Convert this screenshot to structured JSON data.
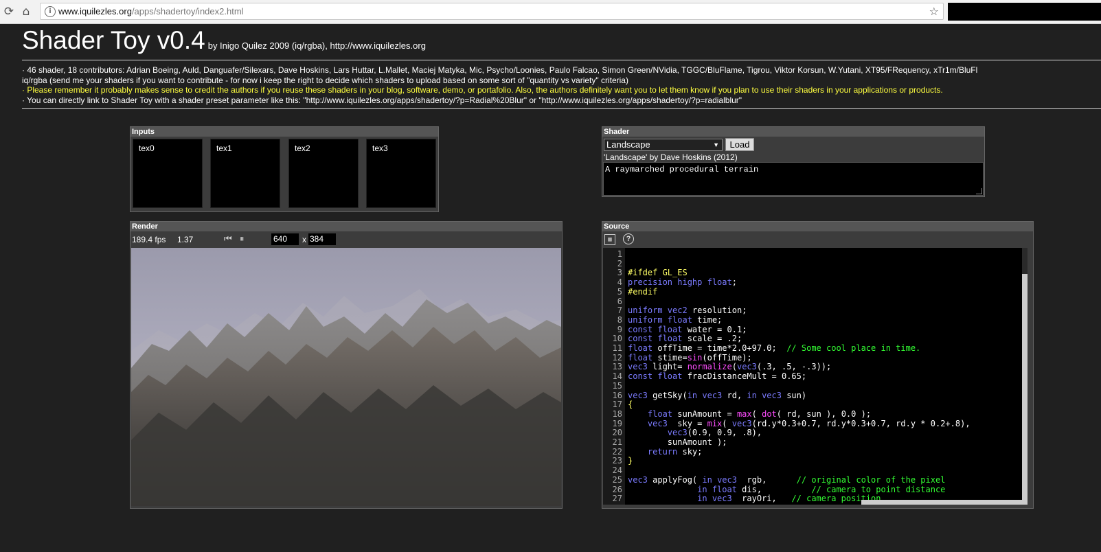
{
  "browser": {
    "url_host": "www.iquilezles.org",
    "url_path": "/apps/shadertoy/index2.html"
  },
  "header": {
    "title": "Shader Toy v0.4",
    "byline": "by Inigo Quilez 2009 (iq/rgba), http://www.iquilezles.org"
  },
  "notes": {
    "line1": "· 46 shader, 18 contributors: Adrian Boeing, Auld, Danguafer/Silexars, Dave Hoskins, Lars Huttar, L.Mallet, Maciej Matyka, Mic, Psycho/Loonies, Paulo Falcao, Simon Green/NVidia, TGGC/BluFlame, Tigrou, Viktor Korsun, W.Yutani, XT95/FRequency, xTr1m/BluFl",
    "line2": "iq/rgba (send me your shaders if you want to contribute - for now i keep the right to decide which shaders to upload based on some sort of \"quantity vs variety\" criteria)",
    "line3": "· Please remember it probably makes sense to credit the authors if you reuse these shaders in your blog, software, demo, or portafolio. Also, the authors definitely want you to let them know if you plan to use their shaders in your applications or products.",
    "line4": "· You can directly link to Shader Toy with a shader preset parameter like this: \"http://www.iquilezles.org/apps/shadertoy/?p=Radial%20Blur\" or \"http://www.iquilezles.org/apps/shadertoy/?p=radialblur\""
  },
  "inputs": {
    "title": "Inputs",
    "tex0": "tex0",
    "tex1": "tex1",
    "tex2": "tex2",
    "tex3": "tex3"
  },
  "shader": {
    "title": "Shader",
    "selected": "Landscape",
    "load_label": "Load",
    "author": "'Landscape' by Dave Hoskins (2012)",
    "description": "A raymarched procedural terrain"
  },
  "render": {
    "title": "Render",
    "fps": "189.4 fps",
    "time": "1.37",
    "width": "640",
    "x_label": "x",
    "height": "384"
  },
  "source": {
    "title": "Source",
    "help": "?"
  },
  "colors": {
    "keyword": "#7b7bff",
    "preprocessor": "#ffff66",
    "builtin": "#ff4dff",
    "comment": "#33ff33",
    "notice": "#ffff40"
  }
}
